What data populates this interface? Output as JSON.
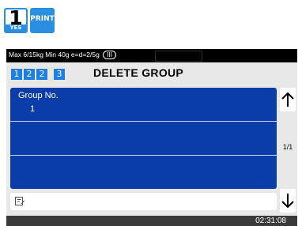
{
  "keys": {
    "yes": {
      "number": "1",
      "label": "YES"
    },
    "print": {
      "label": "PRINT"
    }
  },
  "status_bar": {
    "spec": "Max 6/15kg Min 40g e=d=2/5g",
    "class_badge": "III"
  },
  "header": {
    "steps": [
      "1",
      "2",
      "2",
      "3"
    ],
    "title": "DELETE GROUP"
  },
  "group_list": {
    "label": "Group No.",
    "value": "1"
  },
  "pager": {
    "page": "1/1"
  },
  "clock": "02:31:08",
  "colors": {
    "accent": "#1e7fe0",
    "panel": "#0a3da7",
    "background": "#e8e8e8",
    "frame": "#3a3a3a"
  },
  "icons": [
    "up-arrow-icon",
    "down-arrow-icon",
    "memo-icon"
  ]
}
